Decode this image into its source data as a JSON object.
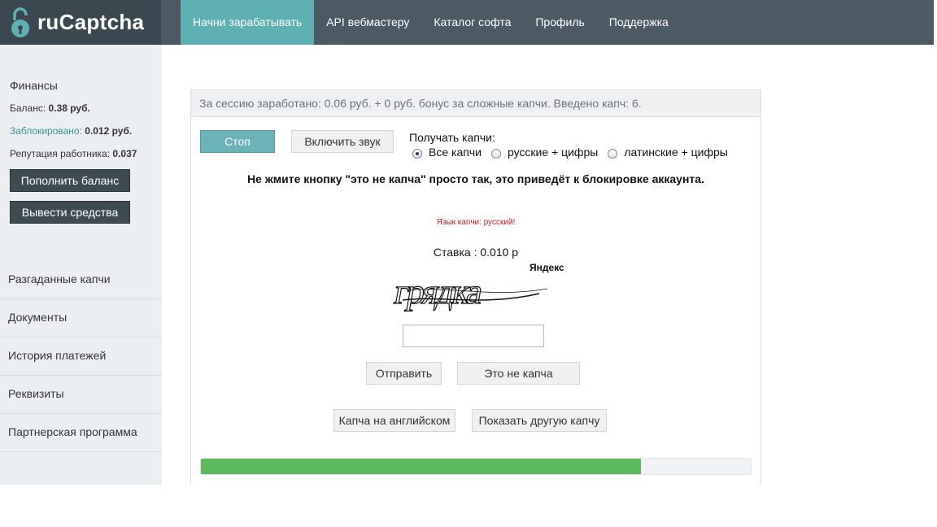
{
  "logo": {
    "text": "ruCaptcha"
  },
  "nav": {
    "items": [
      {
        "label": "Начни зарабатывать",
        "active": true
      },
      {
        "label": "API вебмастеру",
        "active": false
      },
      {
        "label": "Каталог софта",
        "active": false
      },
      {
        "label": "Профиль",
        "active": false
      },
      {
        "label": "Поддержка",
        "active": false
      }
    ]
  },
  "sidebar": {
    "finance_title": "Финансы",
    "balance_label": "Баланс:",
    "balance_value": "0.38 руб.",
    "blocked_label": "Заблокировано:",
    "blocked_value": "0.012 руб.",
    "reputation_label": "Репутация работника:",
    "reputation_value": "0.037",
    "topup_button": "Пополнить баланс",
    "withdraw_button": "Вывести средства",
    "menu": [
      {
        "label": "Разгаданные капчи"
      },
      {
        "label": "Документы"
      },
      {
        "label": "История платежей"
      },
      {
        "label": "Реквизиты"
      },
      {
        "label": "Партнерская программа"
      }
    ]
  },
  "main": {
    "session_text": "За сессию заработано: 0.06 руб. + 0 руб. бонус за сложные капчи. Введено капч: 6.",
    "stop_button": "Стоп",
    "sound_button": "Включить звук",
    "receive_label": "Получать капчи:",
    "radio_options": [
      {
        "label": "Все капчи",
        "selected": true
      },
      {
        "label": "русские + цифры",
        "selected": false
      },
      {
        "label": "латинские + цифры",
        "selected": false
      }
    ],
    "warning": "Не жмите кнопку \"это не капча\" просто так, это приведёт к блокировке аккаунта.",
    "captcha_language": "Язык капчи: русский!",
    "rate": "Ставка : 0.010 р",
    "captcha_word": "грядка",
    "captcha_brand": "Яндекс",
    "answer_value": "",
    "submit_button": "Отправить",
    "not_captcha_button": "Это не капча",
    "english_button": "Капча на английском",
    "another_button": "Показать другую капчу",
    "progress_fraction": 0.8
  },
  "colors": {
    "topbar": "#4c5a63",
    "accent_teal": "#5fb0b3",
    "progress_green": "#5cb85c",
    "language_red": "#cc2222"
  }
}
